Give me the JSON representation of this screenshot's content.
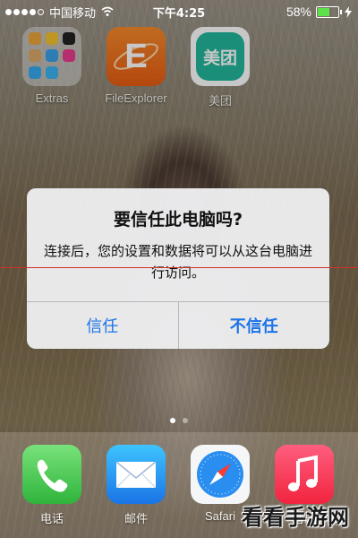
{
  "status_bar": {
    "carrier": "中国移动",
    "time": "下午4:25",
    "battery_percent": "58%",
    "battery_level": 0.58,
    "signal_bars": 4
  },
  "apps": {
    "folder": {
      "label": "Extras"
    },
    "file_explorer": {
      "label": "FileExplorer",
      "glyph": "E"
    },
    "meituan": {
      "label": "美团",
      "glyph": "美团"
    }
  },
  "alert": {
    "title": "要信任此电脑吗?",
    "message": "连接后，您的设置和数据将可以从这台电脑进行访问。",
    "trust_label": "信任",
    "dont_trust_label": "不信任"
  },
  "page_dots": {
    "count": 2,
    "active": 1
  },
  "dock": {
    "phone": {
      "label": "电话"
    },
    "mail": {
      "label": "邮件"
    },
    "safari": {
      "label": "Safari"
    },
    "music": {
      "label": "音乐"
    }
  },
  "watermark": {
    "text": "看看手游网"
  },
  "colors": {
    "button_blue": "#1a73e8",
    "red_guide_line": "#d2302a",
    "battery_green": "#5ee04a"
  }
}
